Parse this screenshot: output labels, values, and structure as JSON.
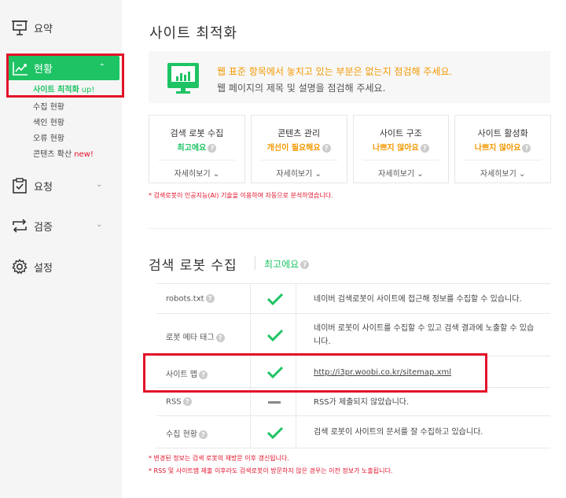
{
  "sidebar": {
    "summary_label": "요약",
    "status_label": "현황",
    "sub_items": [
      {
        "label": "사이트 최적화",
        "badge": "up!"
      },
      {
        "label": "수집 현황",
        "badge": ""
      },
      {
        "label": "색인 현황",
        "badge": ""
      },
      {
        "label": "오류 현황",
        "badge": ""
      },
      {
        "label": "콘텐츠 확산",
        "badge": "new!"
      }
    ],
    "request_label": "요청",
    "verify_label": "검증",
    "settings_label": "설정"
  },
  "main": {
    "title": "사이트 최적화",
    "banner": {
      "line1": "웹 표준 항목에서 놓치고 있는 부분은 없는지 점검해 주세요.",
      "line2": "웹 페이지의 제목 및 설명을 점검해 주세요."
    },
    "cards": [
      {
        "title": "검색 로봇 수집",
        "status": "최고에요",
        "status_color": "#1ec364",
        "more": "자세히보기"
      },
      {
        "title": "콘텐츠 관리",
        "status": "개선이 필요해요",
        "status_color": "#f39800",
        "more": "자세히보기"
      },
      {
        "title": "사이트 구조",
        "status": "나쁘지 않아요",
        "status_color": "#f39800",
        "more": "자세히보기"
      },
      {
        "title": "사이트 활성화",
        "status": "나쁘지 않아요",
        "status_color": "#f39800",
        "more": "자세히보기"
      }
    ],
    "ai_note": "* 검색로봇이 인공지능(AI) 기술을 이용하여 자동으로 분석하였습니다.",
    "section": {
      "title": "검색 로봇 수집",
      "status": "최고에요"
    },
    "rows": [
      {
        "label": "robots.txt",
        "mark": "check",
        "desc": "네이버 검색로봇이 사이트에 접근해 정보를 수집할 수 있습니다."
      },
      {
        "label": "로봇 메타 태그",
        "mark": "check",
        "desc": "네이버 로봇이 사이트를 수집할 수 있고 검색 결과에 노출할 수 있습니다."
      },
      {
        "label": "사이트 맵",
        "mark": "check",
        "desc": "http://i3pr.woobi.co.kr/sitemap.xml"
      },
      {
        "label": "RSS",
        "mark": "dash",
        "desc": "RSS가 제출되지 않았습니다."
      },
      {
        "label": "수집 현황",
        "mark": "check",
        "desc": "검색 로봇이 사이트의 문서를 잘 수집하고 있습니다."
      }
    ],
    "foot_notes": [
      "* 변경된 정보는 검색 로봇의 재방문 이후 갱신됩니다.",
      "* RSS 및 사이트맵 제출 이후라도 검색로봇이 방문하지 않은 경우는 이전 정보가 노출됩니다."
    ]
  },
  "colors": {
    "accent_green": "#1ec364",
    "warning_orange": "#f39800",
    "highlight_red": "#e3122a"
  },
  "icons": {
    "summary": "presentation-board-icon",
    "status": "line-chart-icon",
    "request": "clipboard-check-icon",
    "verify": "swap-arrows-icon",
    "settings": "gear-icon"
  }
}
